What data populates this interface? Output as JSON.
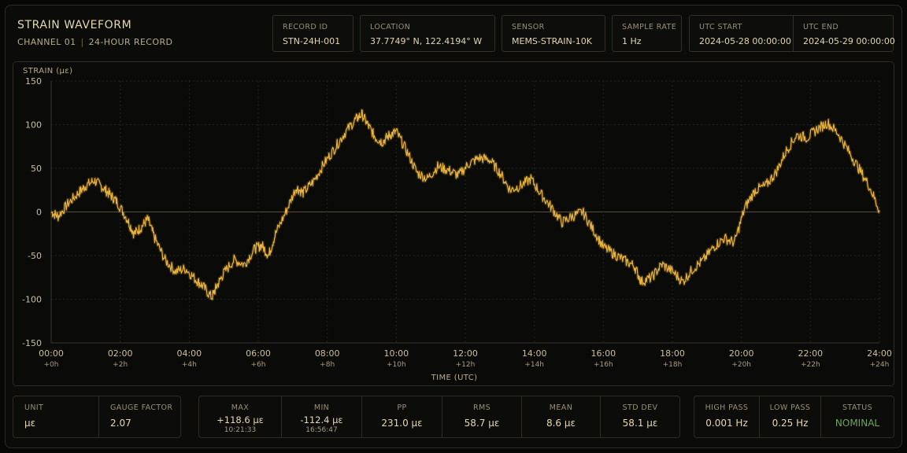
{
  "header": {
    "title": "STRAIN WAVEFORM",
    "channel": "CHANNEL 01",
    "record_type": "24-HOUR RECORD",
    "separator": "|"
  },
  "metadata": [
    {
      "label": "RECORD ID",
      "value": "STN-24H-001"
    },
    {
      "label": "LOCATION",
      "value": "37.7749° N, 122.4194° W"
    },
    {
      "label": "SENSOR",
      "value": "MEMS-STRAIN-10K"
    },
    {
      "label": "SAMPLE RATE",
      "value": "1 Hz"
    },
    {
      "label": "UTC START",
      "value": "2024-05-28 00:00:00"
    },
    {
      "label": "UTC END",
      "value": "2024-05-29 00:00:00"
    }
  ],
  "chart_data": {
    "type": "line",
    "ylabel": "STRAIN (με)",
    "xlabel": "TIME (UTC)",
    "xlim": [
      0,
      24
    ],
    "ylim": [
      -150,
      150
    ],
    "x_unit": "hours",
    "y_ticks": [
      150,
      100,
      50,
      0,
      -50,
      -100,
      -150
    ],
    "x_ticks": [
      {
        "label": "00:00",
        "sub": "+0h"
      },
      {
        "label": "02:00",
        "sub": "+2h"
      },
      {
        "label": "04:00",
        "sub": "+4h"
      },
      {
        "label": "06:00",
        "sub": "+6h"
      },
      {
        "label": "08:00",
        "sub": "+8h"
      },
      {
        "label": "10:00",
        "sub": "+10h"
      },
      {
        "label": "12:00",
        "sub": "+12h"
      },
      {
        "label": "14:00",
        "sub": "+14h"
      },
      {
        "label": "16:00",
        "sub": "+16h"
      },
      {
        "label": "18:00",
        "sub": "+18h"
      },
      {
        "label": "20:00",
        "sub": "+20h"
      },
      {
        "label": "22:00",
        "sub": "+22h"
      },
      {
        "label": "24:00",
        "sub": "+24h"
      }
    ],
    "grid": true,
    "zero_line": true,
    "series": [
      {
        "color": "#e8b23c",
        "x": [
          0,
          0.2,
          0.5,
          0.8,
          1.0,
          1.25,
          1.5,
          1.7,
          1.9,
          2.2,
          2.4,
          2.6,
          2.8,
          3.0,
          3.3,
          3.6,
          3.9,
          4.2,
          4.4,
          4.65,
          4.8,
          5.0,
          5.3,
          5.6,
          5.9,
          6.1,
          6.3,
          6.5,
          6.8,
          7.1,
          7.3,
          7.6,
          7.9,
          8.2,
          8.5,
          8.8,
          9.0,
          9.2,
          9.4,
          9.6,
          9.8,
          10.0,
          10.3,
          10.6,
          10.9,
          11.2,
          11.5,
          11.8,
          12.1,
          12.4,
          12.7,
          13.0,
          13.3,
          13.6,
          13.9,
          14.2,
          14.5,
          14.8,
          15.1,
          15.4,
          15.7,
          16.0,
          16.3,
          16.6,
          16.9,
          17.1,
          17.4,
          17.7,
          18.0,
          18.3,
          18.6,
          18.9,
          19.2,
          19.5,
          19.8,
          20.1,
          20.4,
          20.7,
          21.0,
          21.3,
          21.6,
          21.9,
          22.2,
          22.5,
          22.8,
          23.1,
          23.4,
          23.7,
          24.0
        ],
        "y": [
          0,
          -5,
          10,
          22,
          30,
          36,
          28,
          20,
          12,
          -8,
          -25,
          -18,
          -8,
          -30,
          -55,
          -68,
          -65,
          -78,
          -85,
          -98,
          -85,
          -70,
          -55,
          -60,
          -42,
          -38,
          -50,
          -25,
          0,
          28,
          22,
          35,
          55,
          72,
          90,
          105,
          112,
          98,
          85,
          80,
          88,
          92,
          70,
          45,
          38,
          52,
          48,
          42,
          55,
          62,
          60,
          45,
          25,
          30,
          38,
          20,
          5,
          -12,
          -5,
          0,
          -20,
          -40,
          -48,
          -55,
          -62,
          -80,
          -75,
          -60,
          -68,
          -80,
          -65,
          -55,
          -40,
          -30,
          -35,
          5,
          25,
          30,
          45,
          70,
          88,
          85,
          95,
          102,
          90,
          70,
          50,
          30,
          2
        ]
      }
    ]
  },
  "stats_left": [
    {
      "label": "UNIT",
      "value": "με"
    },
    {
      "label": "GAUGE FACTOR",
      "value": "2.07"
    }
  ],
  "stats_mid": [
    {
      "label": "MAX",
      "value": "+118.6 με",
      "time": "10:21:33"
    },
    {
      "label": "MIN",
      "value": "-112.4 με",
      "time": "16:56:47"
    },
    {
      "label": "PP",
      "value": "231.0 με"
    },
    {
      "label": "RMS",
      "value": "58.7 με"
    },
    {
      "label": "MEAN",
      "value": "8.6 με"
    },
    {
      "label": "STD DEV",
      "value": "58.1 με"
    }
  ],
  "stats_right": [
    {
      "label": "HIGH PASS",
      "value": "0.001 Hz"
    },
    {
      "label": "LOW PASS",
      "value": "0.25 Hz"
    },
    {
      "label": "STATUS",
      "value": "NOMINAL",
      "color": "#6fa35c"
    }
  ]
}
